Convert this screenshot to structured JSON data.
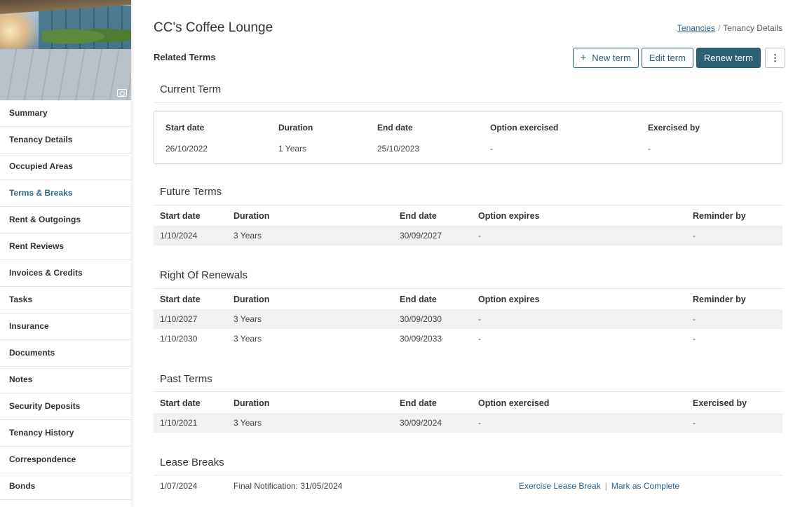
{
  "sidebar": {
    "items": [
      {
        "label": "Summary"
      },
      {
        "label": "Tenancy Details"
      },
      {
        "label": "Occupied Areas"
      },
      {
        "label": "Terms & Breaks"
      },
      {
        "label": "Rent & Outgoings"
      },
      {
        "label": "Rent Reviews"
      },
      {
        "label": "Invoices & Credits"
      },
      {
        "label": "Tasks"
      },
      {
        "label": "Insurance"
      },
      {
        "label": "Documents"
      },
      {
        "label": "Notes"
      },
      {
        "label": "Security Deposits"
      },
      {
        "label": "Tenancy History"
      },
      {
        "label": "Correspondence"
      },
      {
        "label": "Bonds"
      }
    ],
    "active": "Terms & Breaks"
  },
  "header": {
    "title": "CC's Coffee Lounge",
    "breadcrumb": {
      "link": "Tenancies",
      "separator": "/",
      "current": "Tenancy Details"
    },
    "related_terms": "Related Terms"
  },
  "actions": {
    "new_term": "New term",
    "edit_term": "Edit term",
    "renew_term": "Renew term",
    "more": "⋮"
  },
  "current_term": {
    "title": "Current Term",
    "headers": [
      "Start date",
      "Duration",
      "End date",
      "Option exercised",
      "Exercised by"
    ],
    "values": [
      "26/10/2022",
      "1 Years",
      "25/10/2023",
      "-",
      "-"
    ]
  },
  "future_terms": {
    "title": "Future Terms",
    "headers": [
      "Start date",
      "Duration",
      "End date",
      "Option expires",
      "Reminder by"
    ],
    "rows": [
      [
        "1/10/2024",
        "3 Years",
        "30/09/2027",
        "-",
        "-"
      ]
    ]
  },
  "right_of_renewals": {
    "title": "Right Of Renewals",
    "headers": [
      "Start date",
      "Duration",
      "End date",
      "Option expires",
      "Reminder by"
    ],
    "rows": [
      [
        "1/10/2027",
        "3 Years",
        "30/09/2030",
        "-",
        "-"
      ],
      [
        "1/10/2030",
        "3 Years",
        "30/09/2033",
        "-",
        "-"
      ]
    ]
  },
  "past_terms": {
    "title": "Past Terms",
    "headers": [
      "Start date",
      "Duration",
      "End date",
      "Option exercised",
      "Exercised by"
    ],
    "rows": [
      [
        "1/10/2021",
        "3 Years",
        "30/09/2024",
        "-",
        "-"
      ]
    ]
  },
  "lease_breaks": {
    "title": "Lease Breaks",
    "rows": [
      {
        "date": "1/07/2024",
        "note": "Final Notification: 31/05/2024",
        "exercise": "Exercise Lease Break",
        "separator": "|",
        "complete": "Mark as Complete"
      }
    ]
  },
  "colors": {
    "accent": "#2b5f73",
    "link": "#2b5f8a",
    "active_nav": "#2b6a89"
  }
}
